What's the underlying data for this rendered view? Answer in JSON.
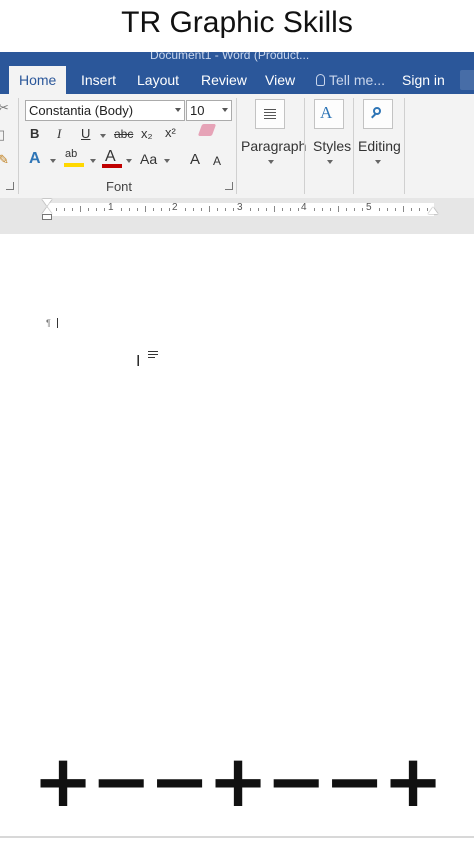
{
  "banner": {
    "title": "TR Graphic Skills"
  },
  "window": {
    "title": "Document1 - Word (Product..."
  },
  "tabs": {
    "items": [
      {
        "label": "Home"
      },
      {
        "label": "Insert"
      },
      {
        "label": "Layout"
      },
      {
        "label": "Review"
      },
      {
        "label": "View"
      }
    ],
    "tell_me": "Tell me...",
    "sign_in": "Sign in"
  },
  "ribbon": {
    "font_name": "Constantia (Body)",
    "font_size": "10",
    "bold": "B",
    "italic": "I",
    "underline": "U",
    "strikethrough": "abc",
    "subscript": "x₂",
    "superscript": "x²",
    "text_effects": "A",
    "highlight": "ab",
    "font_color": "A",
    "change_case": "Aa",
    "grow_font": "A",
    "shrink_font": "A",
    "font_group_label": "Font",
    "paragraph_label": "Paragraph",
    "styles_label": "Styles",
    "editing_label": "Editing"
  },
  "ruler": {
    "numbers": [
      "1",
      "2",
      "3",
      "4",
      "5"
    ]
  },
  "document": {
    "paragraph_mark": "¶"
  },
  "overlay": {
    "shortcut": "+−−+−−+"
  },
  "colors": {
    "word_blue": "#2b579a",
    "ribbon_bg": "#f3f3f3",
    "highlight_yellow": "#ffd800",
    "font_color_red": "#c00000",
    "accent_blue": "#2e75b6"
  }
}
